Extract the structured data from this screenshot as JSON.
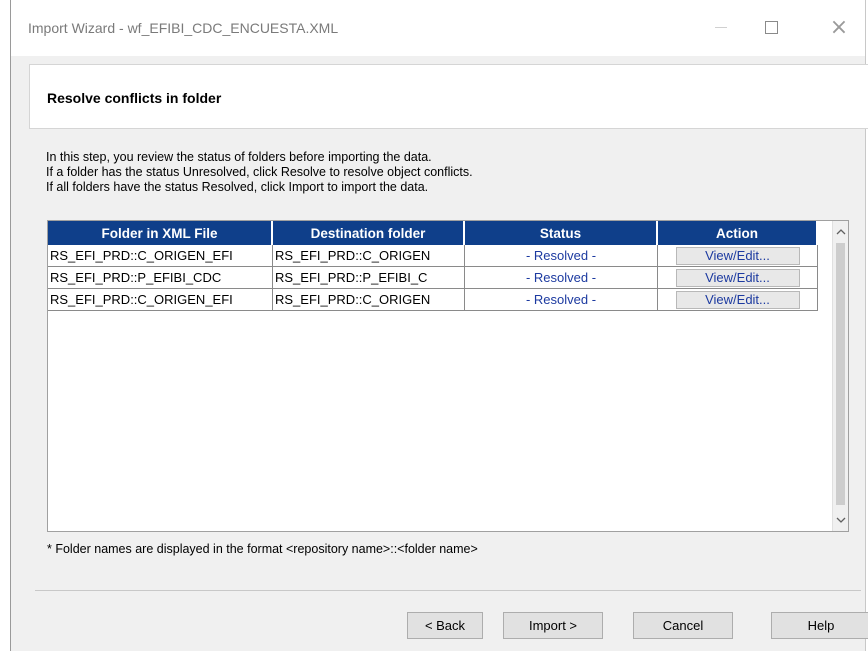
{
  "window": {
    "title": "Import Wizard - wf_EFIBI_CDC_ENCUESTA.XML",
    "close_glyph": "×"
  },
  "header": {
    "title": "Resolve conflicts in folder"
  },
  "instructions": [
    "In this step, you review the status of folders before importing the data.",
    "If a folder has the status Unresolved, click Resolve to resolve object conflicts.",
    "If all folders have the status Resolved, click Import to import the data."
  ],
  "table": {
    "columns": [
      "Folder in XML File",
      "Destination folder",
      "Status",
      "Action"
    ],
    "rows": [
      {
        "folder": "RS_EFI_PRD::C_ORIGEN_EFI",
        "destination": "RS_EFI_PRD::C_ORIGEN",
        "status": "- Resolved -",
        "action": "View/Edit..."
      },
      {
        "folder": "RS_EFI_PRD::P_EFIBI_CDC",
        "destination": "RS_EFI_PRD::P_EFIBI_C",
        "status": "- Resolved -",
        "action": "View/Edit..."
      },
      {
        "folder": "RS_EFI_PRD::C_ORIGEN_EFI",
        "destination": "RS_EFI_PRD::C_ORIGEN",
        "status": "- Resolved -",
        "action": "View/Edit..."
      }
    ],
    "header_color": "#0f3f8a",
    "status_color": "#1c3aa0"
  },
  "footnote": "* Folder names are displayed in the format  <repository name>::<folder name>",
  "buttons": {
    "back": "< Back",
    "import": "Import >",
    "cancel": "Cancel",
    "help": "Help"
  },
  "icons": {
    "minimize": "minimize-icon",
    "maximize": "maximize-icon",
    "close": "close-icon",
    "scroll_up": "chevron-up-icon",
    "scroll_down": "chevron-down-icon"
  }
}
